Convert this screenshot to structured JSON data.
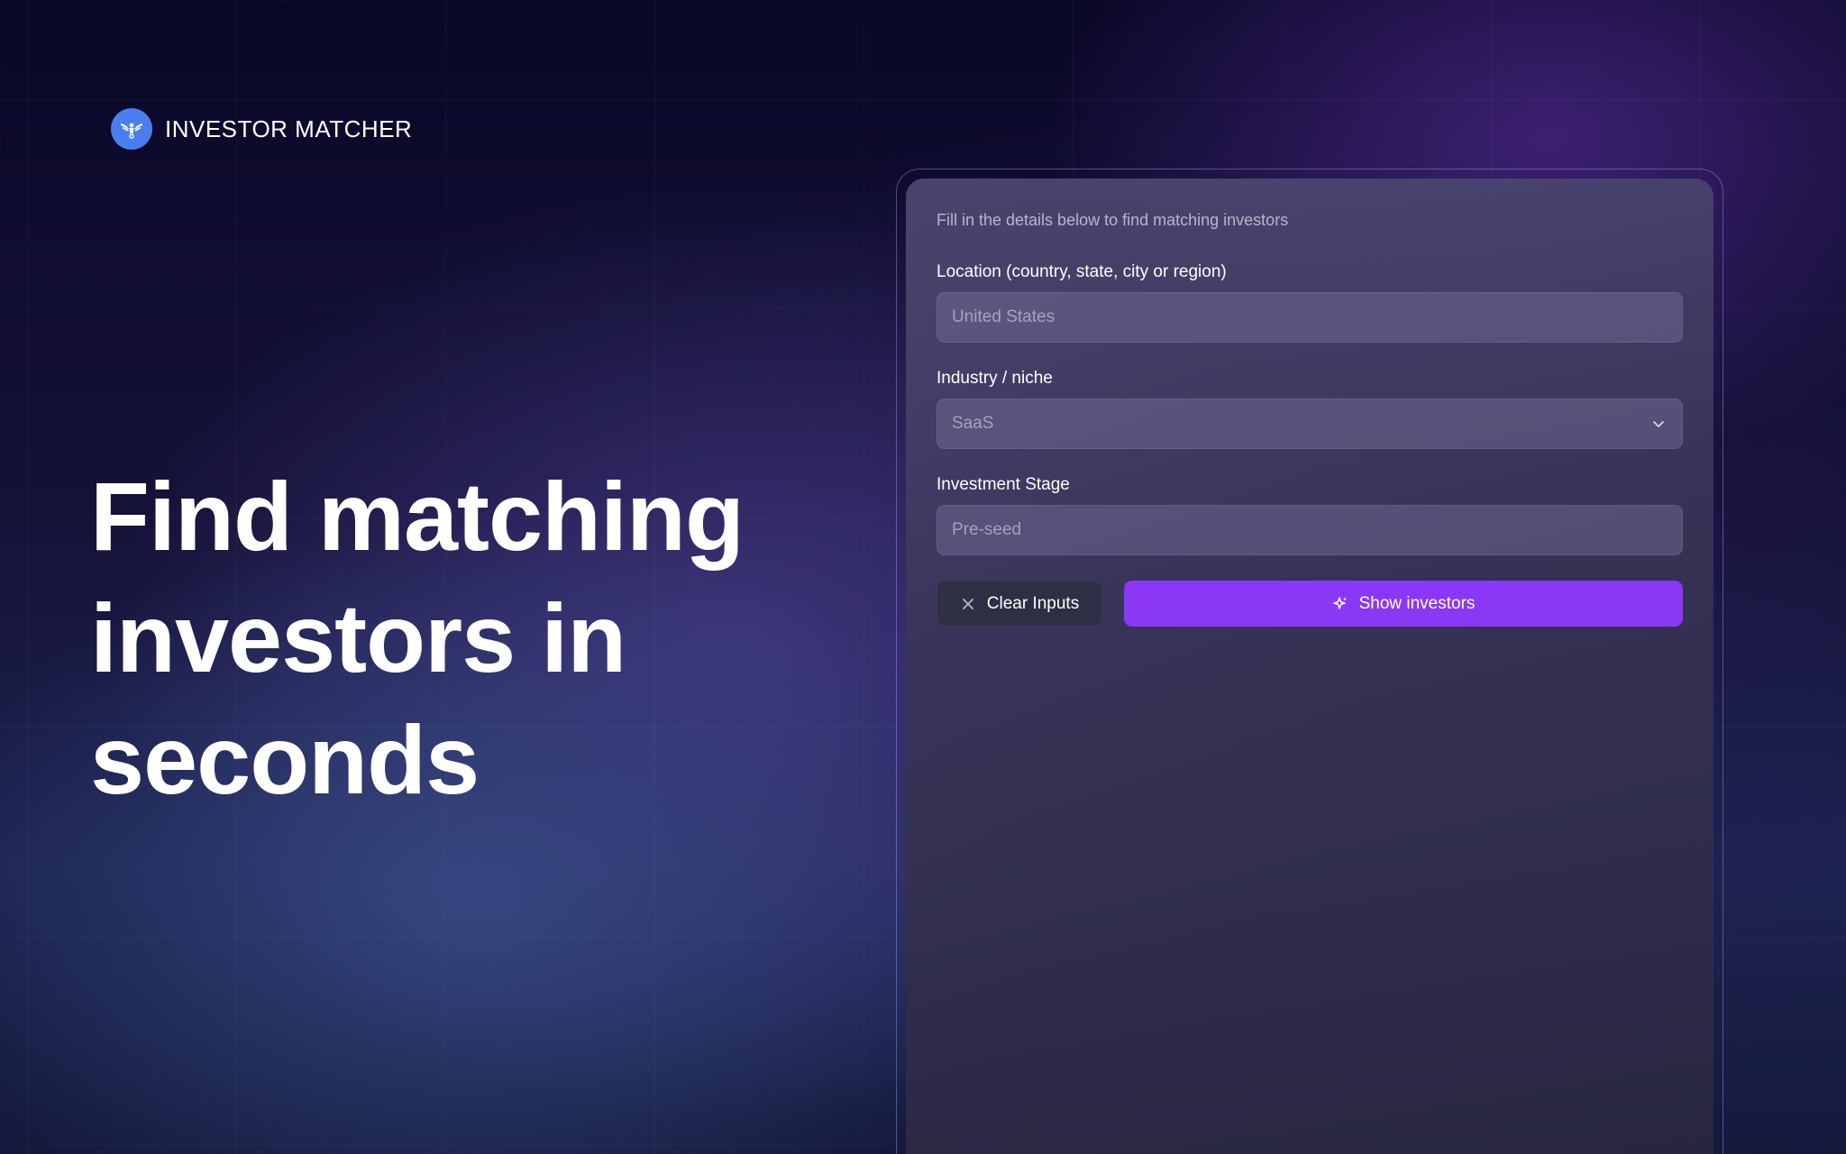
{
  "brand": {
    "name": "INVESTOR MATCHER",
    "logo_icon": "eagle-icon",
    "logo_color": "#4a7ef0"
  },
  "hero": {
    "title": "Find matching investors in seconds"
  },
  "form": {
    "subtitle": "Fill in the details below to find matching investors",
    "location": {
      "label": "Location (country, state, city or region)",
      "placeholder": "United States",
      "value": ""
    },
    "industry": {
      "label": "Industry / niche",
      "selected": "SaaS",
      "icon": "chevron-down-icon"
    },
    "stage": {
      "label": "Investment Stage",
      "placeholder": "Pre-seed",
      "value": ""
    },
    "buttons": {
      "clear_label": "Clear Inputs",
      "clear_icon": "close-icon",
      "show_label": "Show investors",
      "show_icon": "sparkle-icon",
      "show_color": "#8a38f5"
    }
  }
}
